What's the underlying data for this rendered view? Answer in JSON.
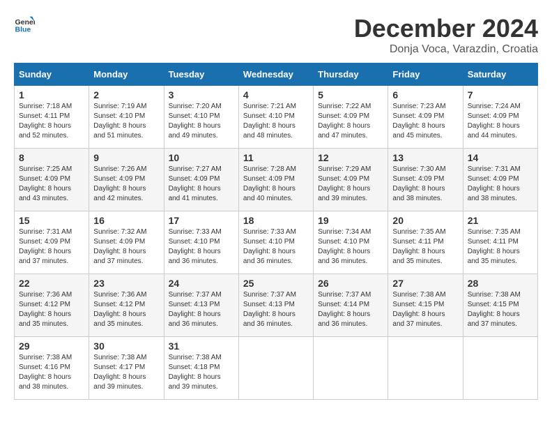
{
  "logo": {
    "text_general": "General",
    "text_blue": "Blue"
  },
  "header": {
    "month": "December 2024",
    "location": "Donja Voca, Varazdin, Croatia"
  },
  "weekdays": [
    "Sunday",
    "Monday",
    "Tuesday",
    "Wednesday",
    "Thursday",
    "Friday",
    "Saturday"
  ],
  "weeks": [
    [
      {
        "day": "1",
        "sunrise": "7:18 AM",
        "sunset": "4:11 PM",
        "daylight": "8 hours and 52 minutes."
      },
      {
        "day": "2",
        "sunrise": "7:19 AM",
        "sunset": "4:10 PM",
        "daylight": "8 hours and 51 minutes."
      },
      {
        "day": "3",
        "sunrise": "7:20 AM",
        "sunset": "4:10 PM",
        "daylight": "8 hours and 49 minutes."
      },
      {
        "day": "4",
        "sunrise": "7:21 AM",
        "sunset": "4:10 PM",
        "daylight": "8 hours and 48 minutes."
      },
      {
        "day": "5",
        "sunrise": "7:22 AM",
        "sunset": "4:09 PM",
        "daylight": "8 hours and 47 minutes."
      },
      {
        "day": "6",
        "sunrise": "7:23 AM",
        "sunset": "4:09 PM",
        "daylight": "8 hours and 45 minutes."
      },
      {
        "day": "7",
        "sunrise": "7:24 AM",
        "sunset": "4:09 PM",
        "daylight": "8 hours and 44 minutes."
      }
    ],
    [
      {
        "day": "8",
        "sunrise": "7:25 AM",
        "sunset": "4:09 PM",
        "daylight": "8 hours and 43 minutes."
      },
      {
        "day": "9",
        "sunrise": "7:26 AM",
        "sunset": "4:09 PM",
        "daylight": "8 hours and 42 minutes."
      },
      {
        "day": "10",
        "sunrise": "7:27 AM",
        "sunset": "4:09 PM",
        "daylight": "8 hours and 41 minutes."
      },
      {
        "day": "11",
        "sunrise": "7:28 AM",
        "sunset": "4:09 PM",
        "daylight": "8 hours and 40 minutes."
      },
      {
        "day": "12",
        "sunrise": "7:29 AM",
        "sunset": "4:09 PM",
        "daylight": "8 hours and 39 minutes."
      },
      {
        "day": "13",
        "sunrise": "7:30 AM",
        "sunset": "4:09 PM",
        "daylight": "8 hours and 38 minutes."
      },
      {
        "day": "14",
        "sunrise": "7:31 AM",
        "sunset": "4:09 PM",
        "daylight": "8 hours and 38 minutes."
      }
    ],
    [
      {
        "day": "15",
        "sunrise": "7:31 AM",
        "sunset": "4:09 PM",
        "daylight": "8 hours and 37 minutes."
      },
      {
        "day": "16",
        "sunrise": "7:32 AM",
        "sunset": "4:09 PM",
        "daylight": "8 hours and 37 minutes."
      },
      {
        "day": "17",
        "sunrise": "7:33 AM",
        "sunset": "4:10 PM",
        "daylight": "8 hours and 36 minutes."
      },
      {
        "day": "18",
        "sunrise": "7:33 AM",
        "sunset": "4:10 PM",
        "daylight": "8 hours and 36 minutes."
      },
      {
        "day": "19",
        "sunrise": "7:34 AM",
        "sunset": "4:10 PM",
        "daylight": "8 hours and 36 minutes."
      },
      {
        "day": "20",
        "sunrise": "7:35 AM",
        "sunset": "4:11 PM",
        "daylight": "8 hours and 35 minutes."
      },
      {
        "day": "21",
        "sunrise": "7:35 AM",
        "sunset": "4:11 PM",
        "daylight": "8 hours and 35 minutes."
      }
    ],
    [
      {
        "day": "22",
        "sunrise": "7:36 AM",
        "sunset": "4:12 PM",
        "daylight": "8 hours and 35 minutes."
      },
      {
        "day": "23",
        "sunrise": "7:36 AM",
        "sunset": "4:12 PM",
        "daylight": "8 hours and 35 minutes."
      },
      {
        "day": "24",
        "sunrise": "7:37 AM",
        "sunset": "4:13 PM",
        "daylight": "8 hours and 36 minutes."
      },
      {
        "day": "25",
        "sunrise": "7:37 AM",
        "sunset": "4:13 PM",
        "daylight": "8 hours and 36 minutes."
      },
      {
        "day": "26",
        "sunrise": "7:37 AM",
        "sunset": "4:14 PM",
        "daylight": "8 hours and 36 minutes."
      },
      {
        "day": "27",
        "sunrise": "7:38 AM",
        "sunset": "4:15 PM",
        "daylight": "8 hours and 37 minutes."
      },
      {
        "day": "28",
        "sunrise": "7:38 AM",
        "sunset": "4:15 PM",
        "daylight": "8 hours and 37 minutes."
      }
    ],
    [
      {
        "day": "29",
        "sunrise": "7:38 AM",
        "sunset": "4:16 PM",
        "daylight": "8 hours and 38 minutes."
      },
      {
        "day": "30",
        "sunrise": "7:38 AM",
        "sunset": "4:17 PM",
        "daylight": "8 hours and 39 minutes."
      },
      {
        "day": "31",
        "sunrise": "7:38 AM",
        "sunset": "4:18 PM",
        "daylight": "8 hours and 39 minutes."
      },
      null,
      null,
      null,
      null
    ]
  ],
  "labels": {
    "sunrise": "Sunrise:",
    "sunset": "Sunset:",
    "daylight": "Daylight hours"
  }
}
